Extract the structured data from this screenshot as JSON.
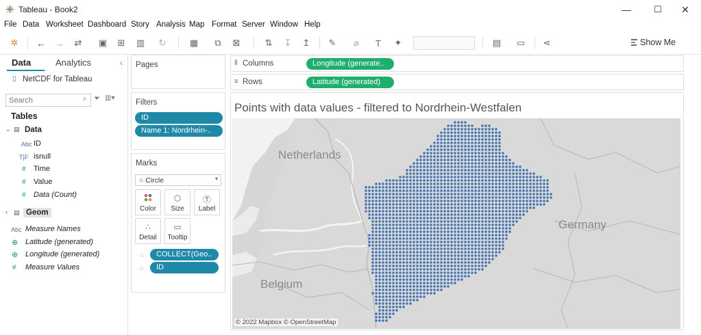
{
  "window": {
    "title": "Tableau - Book2",
    "minimize": "—",
    "maximize": "☐",
    "close": "✕"
  },
  "menu": [
    "File",
    "Data",
    "Worksheet",
    "Dashboard",
    "Story",
    "Analysis",
    "Map",
    "Format",
    "Server",
    "Window",
    "Help"
  ],
  "toolbar": {
    "show_me": "Show Me"
  },
  "data_pane": {
    "tab_data": "Data",
    "tab_analytics": "Analytics",
    "collapse": "‹",
    "datasource": "NetCDF for Tableau",
    "search_placeholder": "Search",
    "tables_label": "Tables",
    "table_data": "Data",
    "data_fields": [
      {
        "type": "Abc",
        "name": "ID"
      },
      {
        "type": "T|F",
        "name": "isnull"
      },
      {
        "type": "#",
        "name": "Time"
      },
      {
        "type": "#",
        "name": "Value"
      },
      {
        "type": "#",
        "name": "Data (Count)"
      }
    ],
    "table_geom": "Geom",
    "other_fields": [
      {
        "type": "Abc",
        "name": "Measure Names"
      },
      {
        "type": "⊕",
        "name": "Latitude (generated)"
      },
      {
        "type": "⊕",
        "name": "Longitude (generated)"
      },
      {
        "type": "#",
        "name": "Measure Values"
      }
    ]
  },
  "pages": {
    "title": "Pages"
  },
  "filters": {
    "title": "Filters",
    "pills": [
      "ID",
      "Name 1: Nordrhein-.."
    ]
  },
  "marks": {
    "title": "Marks",
    "type": "Circle",
    "buttons": [
      "Color",
      "Size",
      "Label",
      "Detail",
      "Tooltip"
    ],
    "pills": [
      "COLLECT(Geo..",
      "ID"
    ]
  },
  "columns": {
    "label": "Columns",
    "pill": "Longitude (generate.."
  },
  "rows": {
    "label": "Rows",
    "pill": "Latitude (generated)"
  },
  "viz": {
    "title": "Points with data values - filtered to Nordrhein-Westfalen",
    "labels": {
      "netherlands": "Netherlands",
      "germany": "Germany",
      "belgium": "Belgium"
    },
    "attribution": "© 2022 Mapbox © OpenStreetMap",
    "point_color": "#3d6fb0"
  }
}
